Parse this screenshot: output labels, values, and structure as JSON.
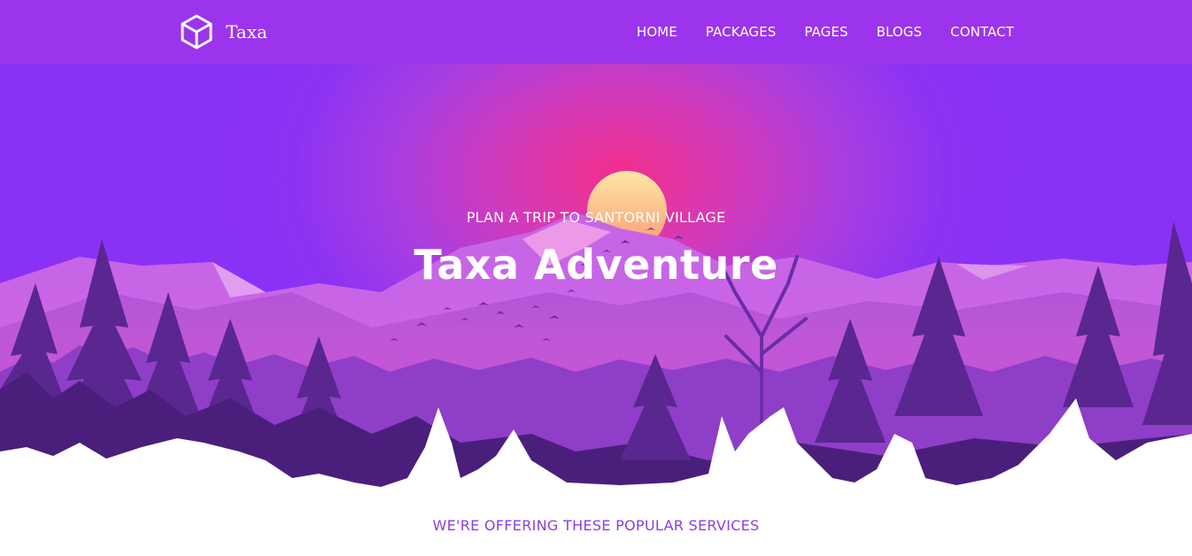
{
  "brand": {
    "name": "Taxa",
    "logo_icon": "cube-icon"
  },
  "nav": {
    "items": [
      {
        "label": "HOME"
      },
      {
        "label": "PACKAGES"
      },
      {
        "label": "PAGES"
      },
      {
        "label": "BLOGS"
      },
      {
        "label": "CONTACT"
      }
    ]
  },
  "hero": {
    "subtitle": "PLAN A TRIP TO SANTORNI VILLAGE",
    "title": "Taxa Adventure"
  },
  "services": {
    "subtitle": "WE'RE OFFERING THESE POPULAR SERVICES"
  },
  "colors": {
    "navbar": "#9b34ec",
    "hero_purple": "#8a31f6",
    "hero_pink": "#f22f8b",
    "accent_text": "#8a3ee2"
  }
}
